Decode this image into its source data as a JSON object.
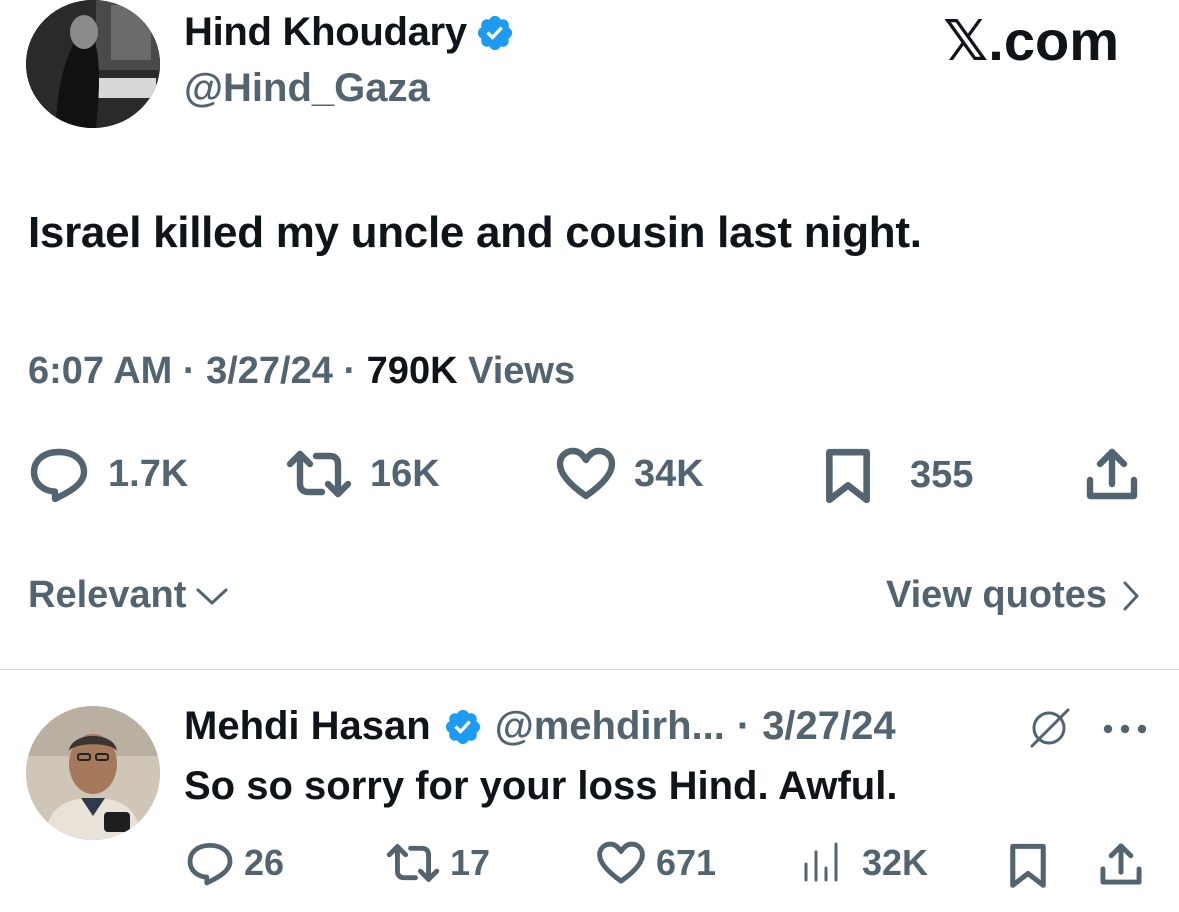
{
  "brand": {
    "label": "𝕏.com"
  },
  "tweet": {
    "author_name": "Hind Khoudary",
    "author_handle": "@Hind_Gaza",
    "text": "Israel killed my uncle and cousin last night.",
    "time": "6:07 AM",
    "date": "3/27/24",
    "views_count": "790K",
    "views_label": "Views",
    "separator": "·",
    "stats": {
      "replies": "1.7K",
      "reposts": "16K",
      "likes": "34K",
      "bookmarks": "355"
    }
  },
  "sort": {
    "label": "Relevant",
    "view_quotes": "View quotes"
  },
  "reply": {
    "author_name": "Mehdi Hasan",
    "author_handle": "@mehdirh...",
    "separator": "·",
    "date": "3/27/24",
    "text": "So so sorry for your loss Hind. Awful.",
    "stats": {
      "replies": "26",
      "reposts": "17",
      "likes": "671",
      "views": "32K"
    }
  },
  "colors": {
    "verified_blue": "#1d9bf0",
    "secondary_text": "#536471",
    "primary_text": "#0f1419",
    "divider": "#cfd9de"
  },
  "icons": {
    "verified": "verified-badge-icon",
    "reply": "speech-bubble-icon",
    "repost": "repost-arrows-icon",
    "like": "heart-icon",
    "bookmark": "bookmark-icon",
    "share": "share-upload-icon",
    "views": "bar-chart-icon",
    "grok": "grok-slash-circle-icon",
    "more": "more-dots-icon",
    "chevron_down": "chevron-down-icon",
    "chevron_right": "chevron-right-icon"
  }
}
